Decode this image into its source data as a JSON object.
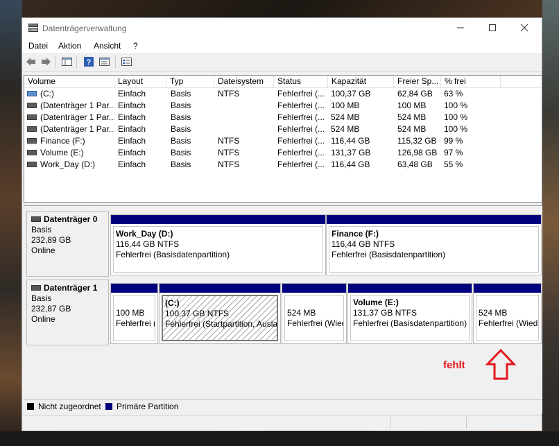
{
  "window": {
    "title": "Datenträgerverwaltung"
  },
  "menu": [
    "Datei",
    "Aktion",
    "Ansicht",
    "?"
  ],
  "columns": [
    "Volume",
    "Layout",
    "Typ",
    "Dateisystem",
    "Status",
    "Kapazität",
    "Freier Sp...",
    "% frei"
  ],
  "volumes": [
    {
      "volume": "(C:)",
      "layout": "Einfach",
      "typ": "Basis",
      "fs": "NTFS",
      "status": "Fehlerfrei (...",
      "cap": "100,37 GB",
      "free": "62,84 GB",
      "pct": "63 %"
    },
    {
      "volume": "(Datenträger 1 Par...",
      "layout": "Einfach",
      "typ": "Basis",
      "fs": "",
      "status": "Fehlerfrei (...",
      "cap": "100 MB",
      "free": "100 MB",
      "pct": "100 %"
    },
    {
      "volume": "(Datenträger 1 Par...",
      "layout": "Einfach",
      "typ": "Basis",
      "fs": "",
      "status": "Fehlerfrei (...",
      "cap": "524 MB",
      "free": "524 MB",
      "pct": "100 %"
    },
    {
      "volume": "(Datenträger 1 Par...",
      "layout": "Einfach",
      "typ": "Basis",
      "fs": "",
      "status": "Fehlerfrei (...",
      "cap": "524 MB",
      "free": "524 MB",
      "pct": "100 %"
    },
    {
      "volume": "Finance (F:)",
      "layout": "Einfach",
      "typ": "Basis",
      "fs": "NTFS",
      "status": "Fehlerfrei (...",
      "cap": "116,44 GB",
      "free": "115,32 GB",
      "pct": "99 %"
    },
    {
      "volume": "Volume (E:)",
      "layout": "Einfach",
      "typ": "Basis",
      "fs": "NTFS",
      "status": "Fehlerfrei (...",
      "cap": "131,37 GB",
      "free": "126,98 GB",
      "pct": "97 %"
    },
    {
      "volume": "Work_Day (D:)",
      "layout": "Einfach",
      "typ": "Basis",
      "fs": "NTFS",
      "status": "Fehlerfrei (...",
      "cap": "116,44 GB",
      "free": "63,48 GB",
      "pct": "55 %"
    }
  ],
  "disks": [
    {
      "name": "Datenträger 0",
      "type": "Basis",
      "size": "232,89 GB",
      "state": "Online",
      "partitions": [
        {
          "name": "Work_Day  (D:)",
          "size": "116,44 GB NTFS",
          "status": "Fehlerfrei (Basisdatenpartition)"
        },
        {
          "name": "Finance  (F:)",
          "size": "116,44 GB NTFS",
          "status": "Fehlerfrei (Basisdatenpartition)"
        }
      ]
    },
    {
      "name": "Datenträger 1",
      "type": "Basis",
      "size": "232,87 GB",
      "state": "Online",
      "partitions": [
        {
          "name": "",
          "size": "100 MB",
          "status": "Fehlerfrei (EFI-Systempartition)"
        },
        {
          "name": "(C:)",
          "size": "100,37 GB NTFS",
          "status": "Fehlerfrei (Startpartition, Auslagerungsdatei)"
        },
        {
          "name": "",
          "size": "524 MB",
          "status": "Fehlerfrei (Wiederherstellungspartition)"
        },
        {
          "name": "Volume  (E:)",
          "size": "131,37 GB NTFS",
          "status": "Fehlerfrei (Basisdatenpartition)"
        },
        {
          "name": "",
          "size": "524 MB",
          "status": "Fehlerfrei (Wiederherstellungspartition)"
        }
      ]
    }
  ],
  "legend": [
    {
      "label": "Nicht zugeordnet",
      "color": "#000000"
    },
    {
      "label": "Primäre Partition",
      "color": "#00007f"
    }
  ],
  "annotation": {
    "text": "fehlt",
    "color": "#e5161b"
  },
  "colors": {
    "partition_bar": "#00007f",
    "window_bg": "#f0f0f0"
  }
}
